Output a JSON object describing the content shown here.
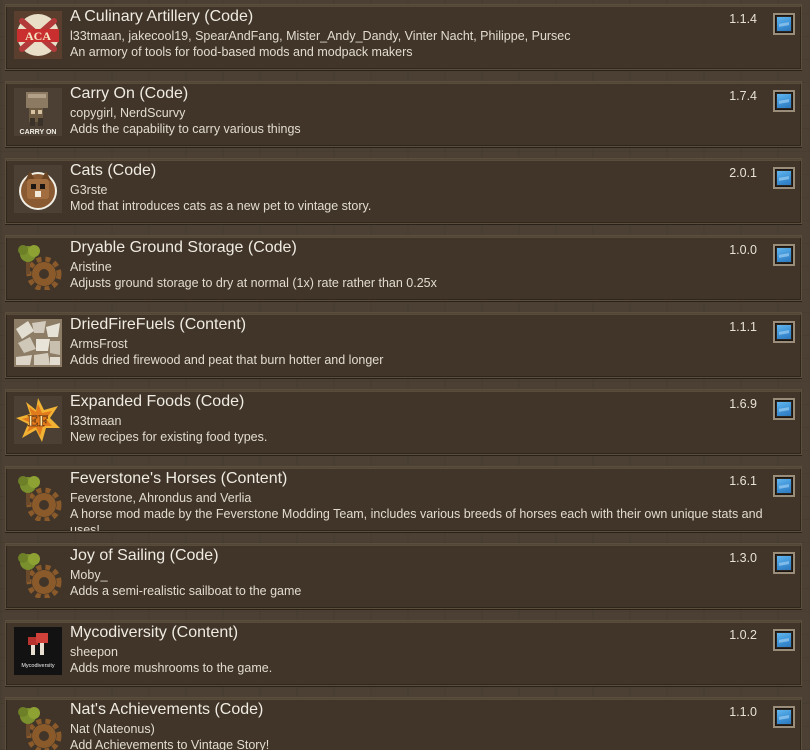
{
  "mods": [
    {
      "title": "A Culinary Artillery (Code)",
      "authors": "l33tmaan, jakecool19, SpearAndFang, Mister_Andy_Dandy, Vinter Nacht, Philippe, Pursec",
      "description": "An armory of tools for food-based mods and modpack makers",
      "version": "1.1.4",
      "icon": "aca-logo-icon",
      "enabled": true
    },
    {
      "title": "Carry On (Code)",
      "authors": "copygirl, NerdScurvy",
      "description": "Adds the capability to carry various things",
      "version": "1.7.4",
      "icon": "carry-on-logo-icon",
      "icon_text": "CARRY ON",
      "enabled": true
    },
    {
      "title": "Cats (Code)",
      "authors": "G3rste",
      "description": "Mod that introduces cats as a new pet to vintage story.",
      "version": "2.0.1",
      "icon": "cat-icon",
      "enabled": true
    },
    {
      "title": "Dryable Ground Storage (Code)",
      "authors": "Aristine",
      "description": "Adjusts ground storage to dry at normal (1x) rate rather than 0.25x",
      "version": "1.0.0",
      "icon": "tree-gear-icon",
      "enabled": true
    },
    {
      "title": "DriedFireFuels (Content)",
      "authors": "ArmsFrost",
      "description": "Adds dried firewood and peat that burn hotter and longer",
      "version": "1.1.1",
      "icon": "firewood-icon",
      "enabled": true
    },
    {
      "title": "Expanded Foods (Code)",
      "authors": "l33tmaan",
      "description": "New recipes for existing food types.",
      "version": "1.6.9",
      "icon": "ef-logo-icon",
      "enabled": true
    },
    {
      "title": "Feverstone's Horses (Content)",
      "authors": "Feverstone, Ahrondus and Verlia",
      "description": "A horse mod made by the Feverstone Modding Team, includes various breeds of horses each with their own unique stats and uses!",
      "version": "1.6.1",
      "icon": "tree-gear-icon",
      "enabled": true
    },
    {
      "title": "Joy of Sailing (Code)",
      "authors": "Moby_",
      "description": "Adds a semi-realistic sailboat to the game",
      "version": "1.3.0",
      "icon": "tree-gear-icon",
      "enabled": true
    },
    {
      "title": "Mycodiversity (Content)",
      "authors": "sheepon",
      "description": "Adds more mushrooms to the game.",
      "version": "1.0.2",
      "icon": "mushroom-logo-icon",
      "icon_text": "Mycodiversity",
      "enabled": true
    },
    {
      "title": "Nat's Achievements (Code)",
      "authors": "Nat (Nateonus)",
      "description": "Add Achievements to Vintage Story!",
      "version": "1.1.0",
      "icon": "tree-gear-icon",
      "enabled": true
    }
  ],
  "colors": {
    "card_bg": "#403528",
    "page_bg": "#4b4033",
    "toggle_on": "#3d92d6",
    "text": "#f0ebe2"
  }
}
